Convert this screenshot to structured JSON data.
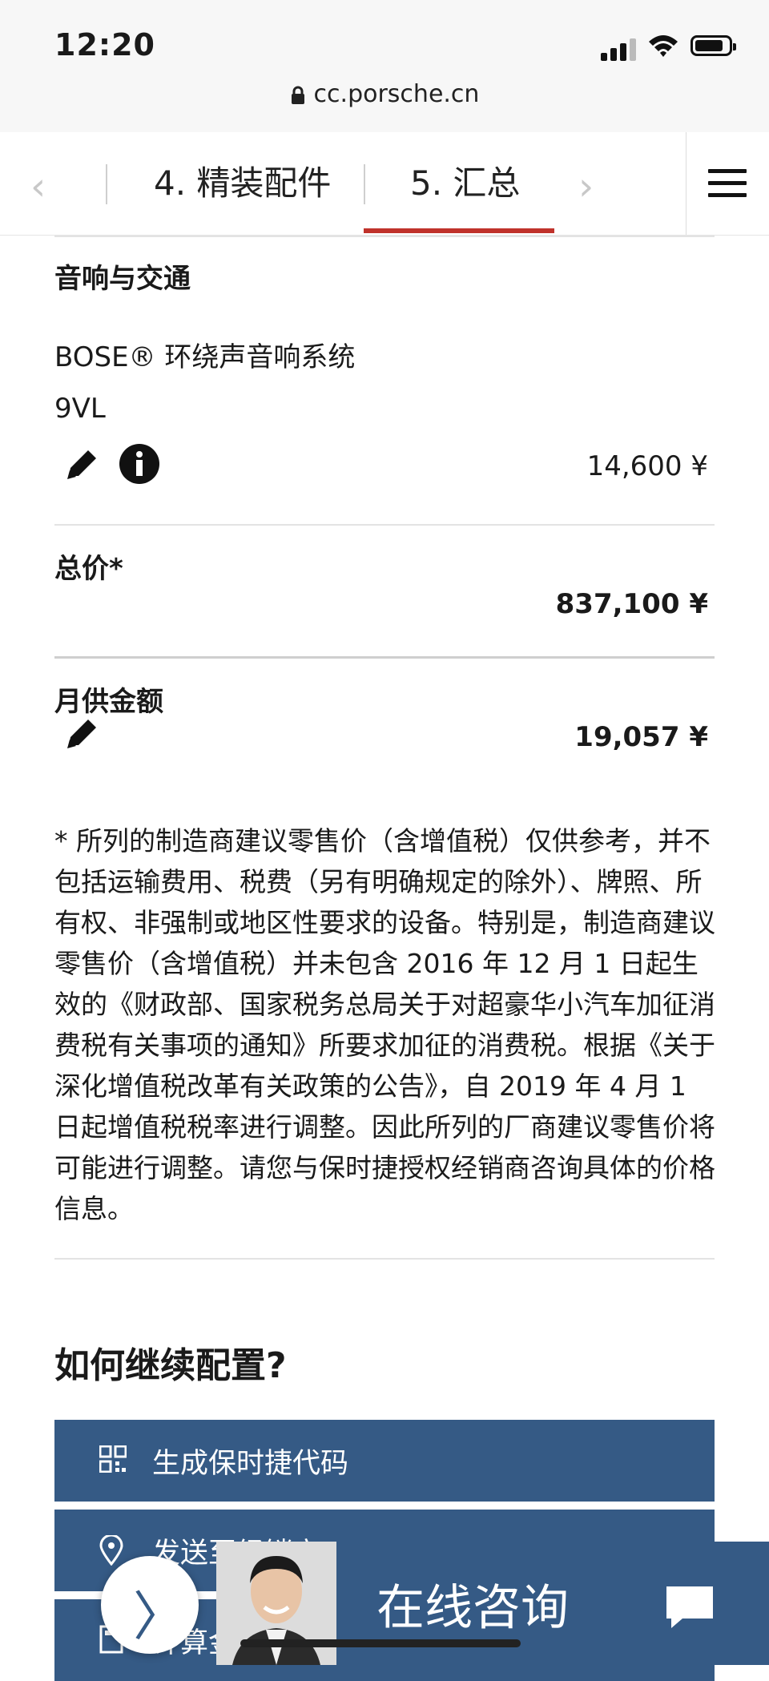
{
  "status_bar": {
    "time": "12:20",
    "url": "cc.porsche.cn"
  },
  "step_nav": {
    "prev_chevron": "‹",
    "next_chevron": "›",
    "steps": [
      {
        "label": "4. 精装配件",
        "active": false
      },
      {
        "label": "5. 汇总",
        "active": true
      }
    ],
    "active_color": "#c0322b"
  },
  "audio_section": {
    "heading": "音响与交通",
    "item_name": "BOSE® 环绕声音响系统",
    "item_code": "9VL",
    "item_price": "14,600 ¥",
    "icons": [
      "pencil-icon",
      "info-icon"
    ]
  },
  "total": {
    "label": "总价*",
    "value": "837,100 ¥"
  },
  "monthly": {
    "label": "月供金额",
    "value": "19,057 ¥",
    "icon": "pencil-icon"
  },
  "disclaimer": "* 所列的制造商建议零售价（含增值税）仅供参考，并不包括运输费用、税费（另有明确规定的除外）、牌照、所有权、非强制或地区性要求的设备。特别是，制造商建议零售价（含增值税）并未包含 2016 年 12 月 1 日起生效的《财政部、国家税务总局关于对超豪华小汽车加征消费税有关事项的通知》所要求加征的消费税。根据《关于深化增值税改革有关政策的公告》，自 2019 年 4 月 1 日起增值税税率进行调整。因此所列的厂商建议零售价将可能进行调整。请您与保时捷授权经销商咨询具体的价格信息。",
  "continue": {
    "heading": "如何继续配置?",
    "buttons": [
      {
        "label": "生成保时捷代码",
        "icon": "qr-code-icon"
      },
      {
        "label": "发送至经销商",
        "icon": "location-pin-icon"
      },
      {
        "label": "计算金融方案",
        "icon": "calculator-icon"
      }
    ],
    "button_color": "#355a85"
  },
  "chat": {
    "label": "在线咨询",
    "toggle_arrow": "〉"
  }
}
